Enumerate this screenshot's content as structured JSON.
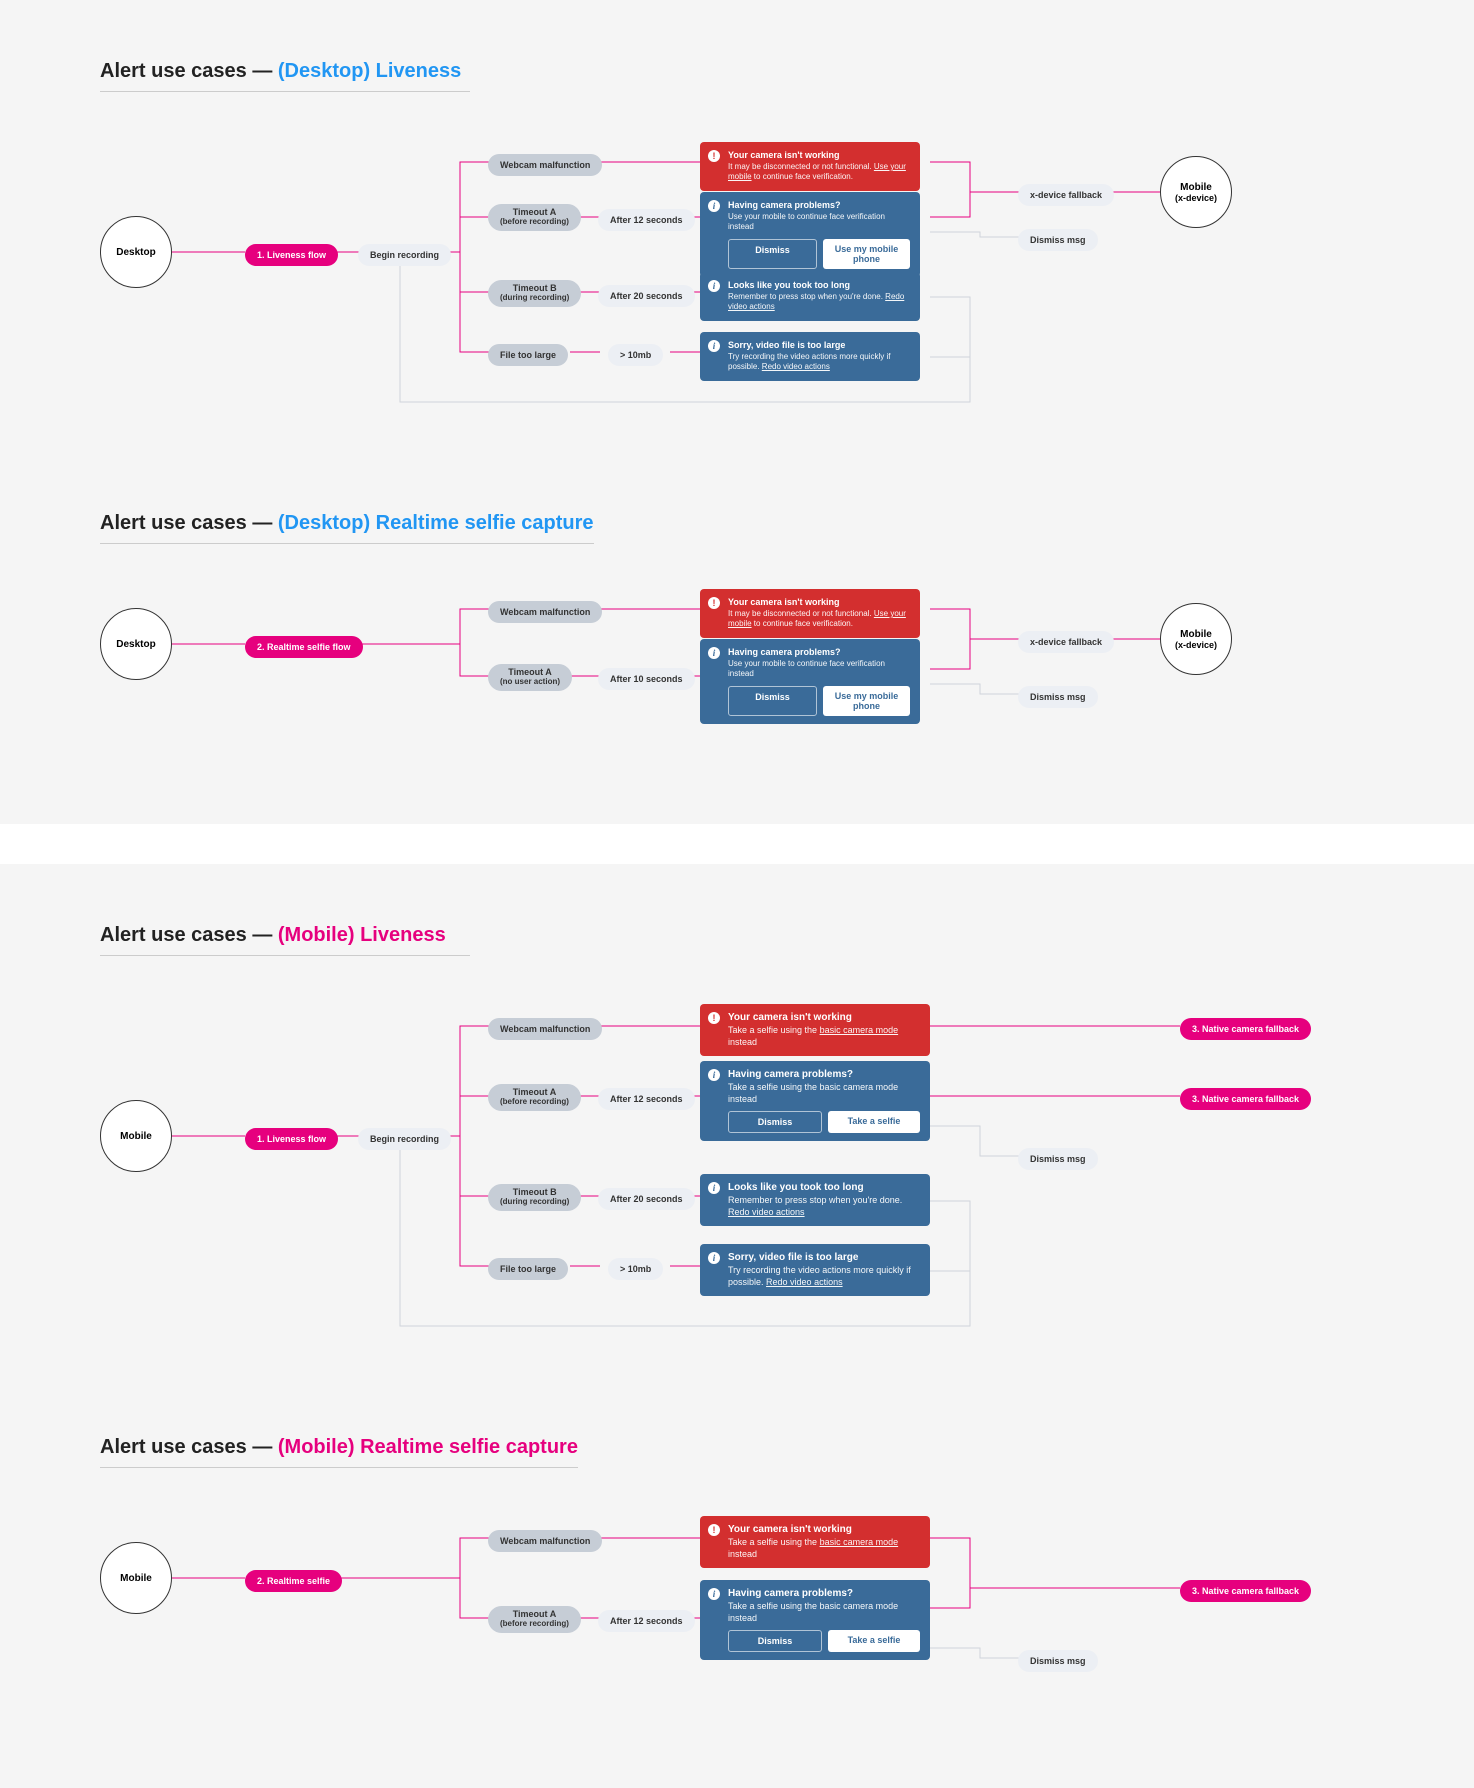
{
  "sections": {
    "desktop_liveness": {
      "title_prefix": "Alert use cases — ",
      "title_accent": "(Desktop) Liveness",
      "start": "Desktop",
      "flow": "1. Liveness flow",
      "begin": "Begin recording",
      "branches": {
        "webcam": "Webcam malfunction",
        "timeout_a": {
          "label": "Timeout A",
          "sub": "(before recording)",
          "pill": "After 12 seconds"
        },
        "timeout_b": {
          "label": "Timeout B",
          "sub": "(during recording)",
          "pill": "After 20 seconds"
        },
        "file": {
          "label": "File too large",
          "pill": "> 10mb"
        }
      },
      "alerts": {
        "red": {
          "title": "Your camera isn't working",
          "body_a": "It may be disconnected or not functional. ",
          "link": "Use your mobile",
          "body_b": " to continue face verification."
        },
        "blue1": {
          "title": "Having camera problems?",
          "body": "Use your mobile to continue face verification instead",
          "btn_a": "Dismiss",
          "btn_b": "Use my mobile phone"
        },
        "blue2": {
          "title": "Looks like you took too long",
          "body_a": "Remember to press stop when you're done. ",
          "link": "Redo video actions"
        },
        "blue3": {
          "title": "Sorry, video file is too large",
          "body_a": "Try recording the video actions more quickly if possible. ",
          "link": "Redo video actions"
        }
      },
      "end": {
        "fallback": "x-device fallback",
        "dismiss": "Dismiss msg",
        "circle_a": "Mobile",
        "circle_b": "(x-device)"
      }
    },
    "desktop_selfie": {
      "title_prefix": "Alert use cases — ",
      "title_accent": "(Desktop) Realtime selfie capture",
      "start": "Desktop",
      "flow": "2. Realtime selfie flow",
      "branches": {
        "webcam": "Webcam malfunction",
        "timeout_a": {
          "label": "Timeout A",
          "sub": "(no user action)",
          "pill": "After 10 seconds"
        }
      },
      "alerts": {
        "red": {
          "title": "Your camera isn't working",
          "body_a": "It may be disconnected or not functional. ",
          "link": "Use your mobile",
          "body_b": " to continue face verification."
        },
        "blue1": {
          "title": "Having camera problems?",
          "body": "Use your mobile to continue face verification instead",
          "btn_a": "Dismiss",
          "btn_b": "Use my mobile phone"
        }
      },
      "end": {
        "fallback": "x-device fallback",
        "dismiss": "Dismiss msg",
        "circle_a": "Mobile",
        "circle_b": "(x-device)"
      }
    },
    "mobile_liveness": {
      "title_prefix": "Alert use cases — ",
      "title_accent": "(Mobile) Liveness",
      "start": "Mobile",
      "flow": "1. Liveness flow",
      "begin": "Begin recording",
      "branches": {
        "webcam": "Webcam malfunction",
        "timeout_a": {
          "label": "Timeout A",
          "sub": "(before recording)",
          "pill": "After 12 seconds"
        },
        "timeout_b": {
          "label": "Timeout B",
          "sub": "(during recording)",
          "pill": "After 20 seconds"
        },
        "file": {
          "label": "File too large",
          "pill": "> 10mb"
        }
      },
      "alerts": {
        "red": {
          "title": "Your camera isn't working",
          "body_a": "Take a selfie using the ",
          "link": "basic camera mode",
          "body_b": " instead"
        },
        "blue1": {
          "title": "Having camera problems?",
          "body": "Take a selfie using the basic camera mode instead",
          "btn_a": "Dismiss",
          "btn_b": "Take a selfie"
        },
        "blue2": {
          "title": "Looks like you took too long",
          "body_a": "Remember to press stop when you're done. ",
          "link": "Redo video actions"
        },
        "blue3": {
          "title": "Sorry, video file is too large",
          "body_a": "Try recording the video actions more quickly if possible. ",
          "link": "Redo video actions"
        }
      },
      "end": {
        "fallback1": "3. Native camera fallback",
        "fallback2": "3. Native camera fallback",
        "dismiss": "Dismiss msg"
      }
    },
    "mobile_selfie": {
      "title_prefix": "Alert use cases — ",
      "title_accent": "(Mobile) Realtime selfie capture",
      "start": "Mobile",
      "flow": "2. Realtime selfie",
      "branches": {
        "webcam": "Webcam malfunction",
        "timeout_a": {
          "label": "Timeout A",
          "sub": "(before recording)",
          "pill": "After 12 seconds"
        }
      },
      "alerts": {
        "red": {
          "title": "Your camera isn't working",
          "body_a": "Take a selfie using the ",
          "link": "basic camera mode",
          "body_b": " instead"
        },
        "blue1": {
          "title": "Having camera problems?",
          "body": "Take a selfie using the basic camera mode instead",
          "btn_a": "Dismiss",
          "btn_b": "Take a selfie"
        }
      },
      "end": {
        "fallback": "3. Native camera fallback",
        "dismiss": "Dismiss msg"
      }
    }
  }
}
